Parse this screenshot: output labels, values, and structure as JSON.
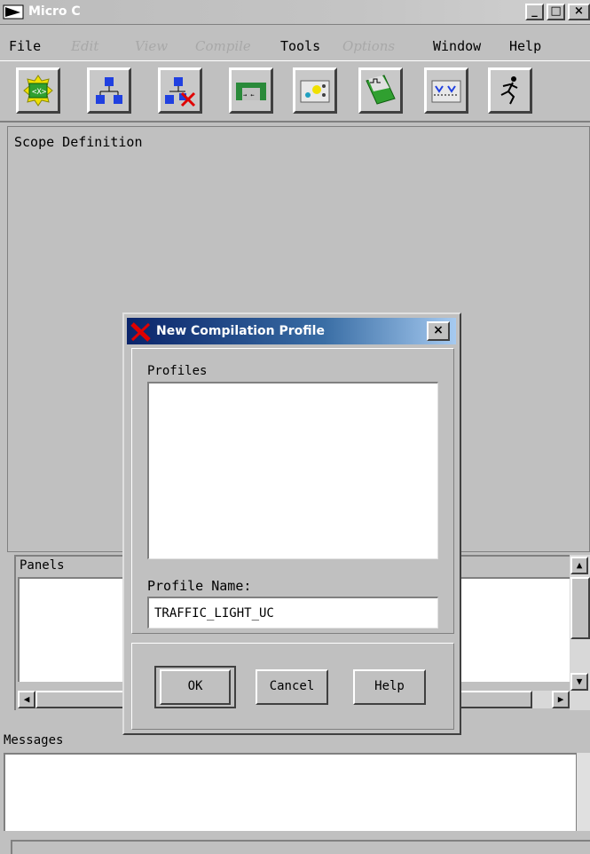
{
  "window": {
    "title": "Micro C",
    "controls": [
      "_",
      "□",
      "×"
    ]
  },
  "menu": [
    {
      "label": "File",
      "enabled": true
    },
    {
      "label": "Edit",
      "enabled": false
    },
    {
      "label": "View",
      "enabled": false
    },
    {
      "label": "Compile",
      "enabled": false
    },
    {
      "label": "Tools",
      "enabled": true
    },
    {
      "label": "Options",
      "enabled": false
    },
    {
      "label": "Window",
      "enabled": true
    },
    {
      "label": "Help",
      "enabled": true
    }
  ],
  "toolbar": {
    "icons": [
      "chip-icon",
      "hierarchy-icon",
      "hierarchy-delete-icon",
      "connect-icon",
      "probe-board-icon",
      "waveform-stack-icon",
      "trigger-icon",
      "run-icon"
    ]
  },
  "scope": {
    "label": "Scope Definition"
  },
  "panels": {
    "label": "Panels",
    "arrow_up": "▲",
    "arrow_down": "▼",
    "arrow_left": "◀",
    "arrow_right": "▶"
  },
  "messages": {
    "label": "Messages"
  },
  "dialog": {
    "title": "New Compilation Profile",
    "close_glyph": "×",
    "profiles_label": "Profiles",
    "profiles": [],
    "name_label": "Profile Name:",
    "name_value": "TRAFFIC_LIGHT_UC",
    "buttons": {
      "ok": "OK",
      "cancel": "Cancel",
      "help": "Help"
    }
  },
  "colors": {
    "dialog_title_start": "#0a246a",
    "dialog_title_end": "#a6caf0",
    "close_x_red": "#e00000",
    "face": "#c0c0c0"
  }
}
